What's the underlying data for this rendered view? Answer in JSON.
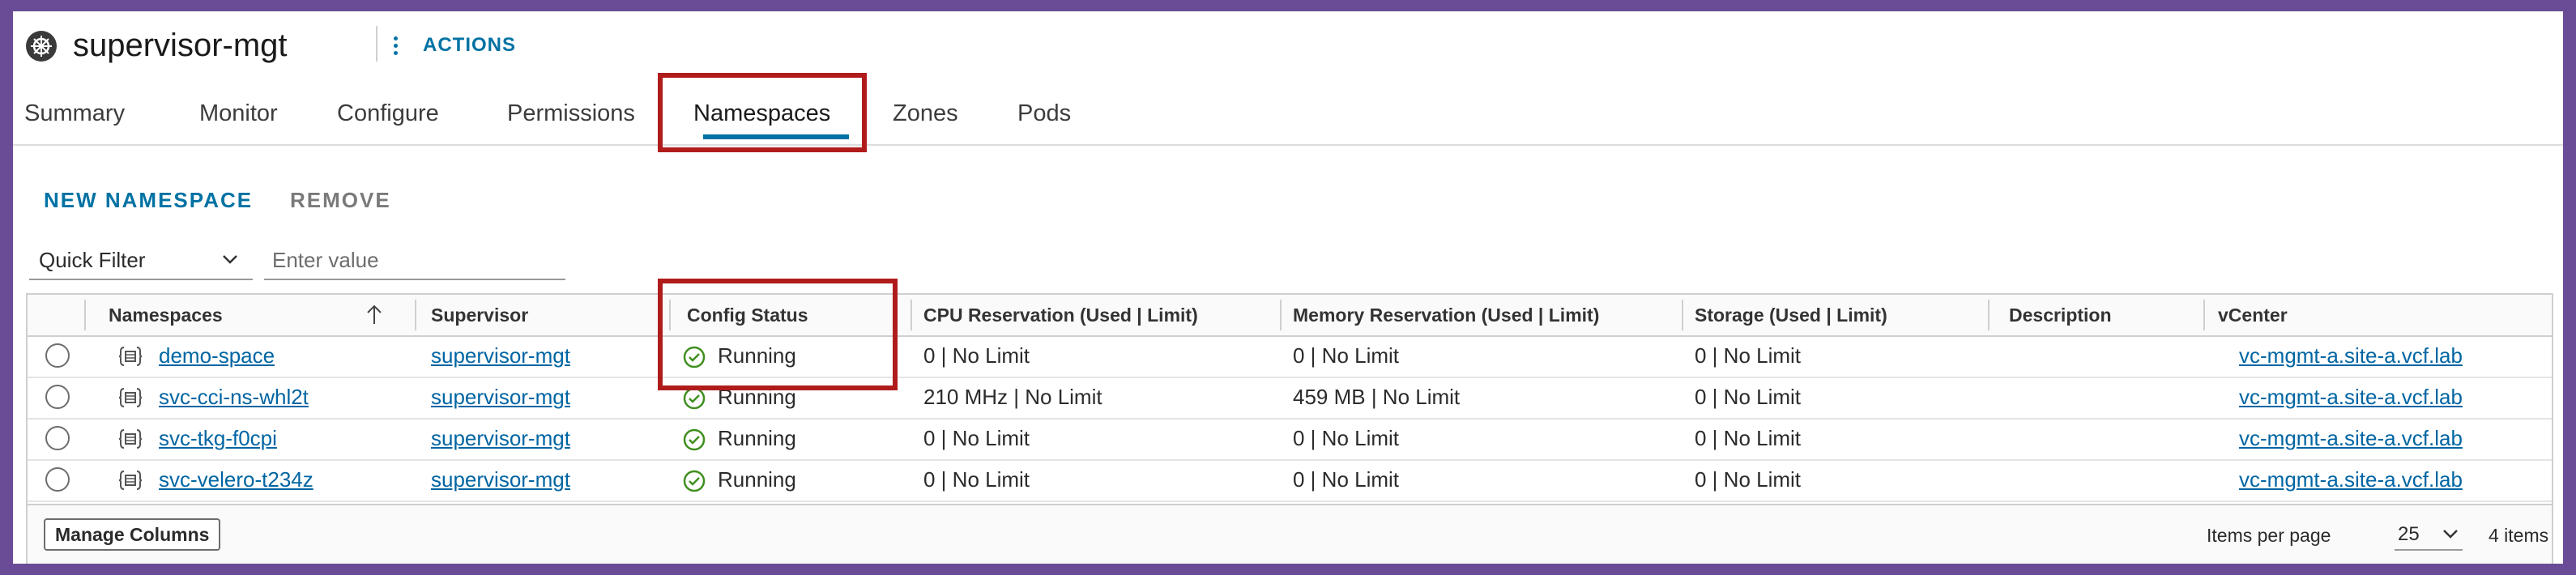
{
  "header": {
    "title": "supervisor-mgt",
    "object_icon": "kubernetes-helm-icon",
    "actions_label": "ACTIONS"
  },
  "tabs": [
    {
      "label": "Summary",
      "active": false
    },
    {
      "label": "Monitor",
      "active": false
    },
    {
      "label": "Configure",
      "active": false
    },
    {
      "label": "Permissions",
      "active": false
    },
    {
      "label": "Namespaces",
      "active": true
    },
    {
      "label": "Zones",
      "active": false
    },
    {
      "label": "Pods",
      "active": false
    }
  ],
  "toolbar": {
    "new_label": "NEW NAMESPACE",
    "remove_label": "REMOVE"
  },
  "filter": {
    "quick_filter_label": "Quick Filter",
    "value_placeholder": "Enter value",
    "value": ""
  },
  "grid": {
    "columns": [
      "Namespaces",
      "Supervisor",
      "Config Status",
      "CPU Reservation (Used | Limit)",
      "Memory Reservation (Used | Limit)",
      "Storage (Used | Limit)",
      "Description",
      "vCenter"
    ],
    "rows": [
      {
        "namespace": "demo-space",
        "supervisor": "supervisor-mgt",
        "status": "Running",
        "cpu": "0 | No Limit",
        "memory": "0 | No Limit",
        "storage": "0 | No Limit",
        "description": "",
        "vcenter": "vc-mgmt-a.site-a.vcf.lab"
      },
      {
        "namespace": "svc-cci-ns-whl2t",
        "supervisor": "supervisor-mgt",
        "status": "Running",
        "cpu": "210 MHz | No Limit",
        "memory": "459 MB | No Limit",
        "storage": "0 | No Limit",
        "description": "",
        "vcenter": "vc-mgmt-a.site-a.vcf.lab"
      },
      {
        "namespace": "svc-tkg-f0cpi",
        "supervisor": "supervisor-mgt",
        "status": "Running",
        "cpu": "0 | No Limit",
        "memory": "0 | No Limit",
        "storage": "0 | No Limit",
        "description": "",
        "vcenter": "vc-mgmt-a.site-a.vcf.lab"
      },
      {
        "namespace": "svc-velero-t234z",
        "supervisor": "supervisor-mgt",
        "status": "Running",
        "cpu": "0 | No Limit",
        "memory": "0 | No Limit",
        "storage": "0 | No Limit",
        "description": "",
        "vcenter": "vc-mgmt-a.site-a.vcf.lab"
      }
    ],
    "footer": {
      "manage_columns_label": "Manage Columns",
      "items_per_page_label": "Items per page",
      "items_per_page_value": "25",
      "item_count": "4 items"
    }
  },
  "colors": {
    "accent": "#0072a3",
    "highlight": "#b01c1c",
    "frame": "#6a4c96",
    "status_ok": "#3f8f1f"
  },
  "icons": {
    "namespace_icon": "namespace-icon",
    "status_icon": "check-circle-icon",
    "sort_icon": "sort-ascending-icon"
  }
}
